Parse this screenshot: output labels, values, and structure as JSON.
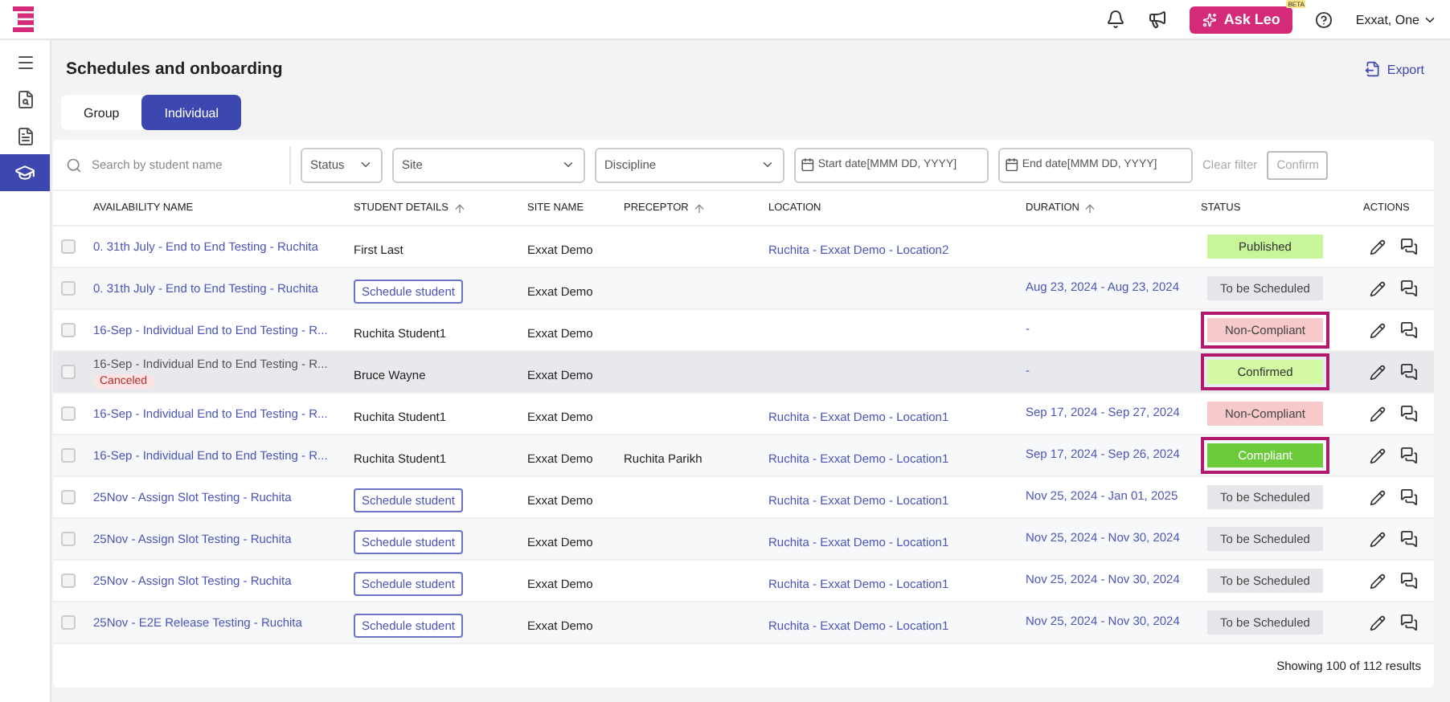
{
  "topbar": {
    "ask_button": "Ask Leo",
    "beta_badge": "BETA",
    "user": "Exxat, One"
  },
  "sidebar": {
    "items": [
      {
        "kind": "menu",
        "selected": false
      },
      {
        "kind": "search-doc",
        "selected": false
      },
      {
        "kind": "doc",
        "selected": false
      },
      {
        "kind": "cap",
        "selected": true
      }
    ]
  },
  "page": {
    "title": "Schedules and onboarding",
    "export": "Export"
  },
  "tabs": [
    {
      "label": "Group",
      "selected": false
    },
    {
      "label": "Individual",
      "selected": true
    }
  ],
  "filters": {
    "search_placeholder": "Search by student name",
    "status": "Status",
    "site": "Site",
    "discipline": "Discipline",
    "start_placeholder": "Start date[MMM DD, YYYY]",
    "end_placeholder": "End date[MMM DD, YYYY]",
    "clear": "Clear filter",
    "confirm": "Confirm"
  },
  "table": {
    "columns": [
      {
        "label": "AVAILABILITY NAME",
        "sortable": false
      },
      {
        "label": "STUDENT DETAILS",
        "sortable": true
      },
      {
        "label": "SITE NAME",
        "sortable": false
      },
      {
        "label": "PRECEPTOR",
        "sortable": true
      },
      {
        "label": "LOCATION",
        "sortable": false
      },
      {
        "label": "DURATION",
        "sortable": true
      },
      {
        "label": "STATUS",
        "sortable": false
      },
      {
        "label": "ACTIONS",
        "sortable": false
      }
    ],
    "rows": [
      {
        "name": "0. 31th July - End to End Testing - Ruchita",
        "canceled": false,
        "student": {
          "kind": "text",
          "text": "First Last"
        },
        "site": "Exxat Demo",
        "preceptor": "",
        "location": "Ruchita - Exxat Demo - Location2",
        "duration": "",
        "status": {
          "kind": "published",
          "text": "Published"
        },
        "highlighted": false
      },
      {
        "name": "0. 31th July - End to End Testing - Ruchita",
        "canceled": false,
        "student": {
          "kind": "button",
          "text": "Schedule student"
        },
        "site": "Exxat Demo",
        "preceptor": "",
        "location": "",
        "duration": "Aug 23, 2024 - Aug 23, 2024",
        "status": {
          "kind": "pending",
          "text": "To be Scheduled"
        },
        "highlighted": false
      },
      {
        "name": "16-Sep - Individual End to End Testing - R...",
        "canceled": false,
        "student": {
          "kind": "text",
          "text": "Ruchita Student1"
        },
        "site": "Exxat Demo",
        "preceptor": "",
        "location": "",
        "duration": "-",
        "status": {
          "kind": "noncompliant",
          "text": "Non-Compliant"
        },
        "highlighted": true
      },
      {
        "name": "16-Sep - Individual End to End Testing - R...",
        "canceled": true,
        "cancel_label": "Canceled",
        "student": {
          "kind": "text",
          "text": "Bruce Wayne"
        },
        "site": "Exxat Demo",
        "preceptor": "",
        "location": "",
        "duration": "-",
        "status": {
          "kind": "confirmed",
          "text": "Confirmed"
        },
        "highlighted": true
      },
      {
        "name": "16-Sep - Individual End to End Testing - R...",
        "canceled": false,
        "student": {
          "kind": "text",
          "text": "Ruchita Student1"
        },
        "site": "Exxat Demo",
        "preceptor": "",
        "location": "Ruchita - Exxat Demo - Location1",
        "duration": "Sep 17, 2024 - Sep 27, 2024",
        "status": {
          "kind": "noncompliant",
          "text": "Non-Compliant"
        },
        "highlighted": false
      },
      {
        "name": "16-Sep - Individual End to End Testing - R...",
        "canceled": false,
        "student": {
          "kind": "text",
          "text": "Ruchita Student1"
        },
        "site": "Exxat Demo",
        "preceptor": "Ruchita Parikh",
        "location": "Ruchita - Exxat Demo - Location1",
        "duration": "Sep 17, 2024 - Sep 26, 2024",
        "status": {
          "kind": "compliant",
          "text": "Compliant"
        },
        "highlighted": true
      },
      {
        "name": "25Nov - Assign Slot Testing - Ruchita",
        "canceled": false,
        "student": {
          "kind": "button",
          "text": "Schedule student"
        },
        "site": "Exxat Demo",
        "preceptor": "",
        "location": "Ruchita - Exxat Demo - Location1",
        "duration": "Nov 25, 2024 - Jan 01, 2025",
        "status": {
          "kind": "pending",
          "text": "To be Scheduled"
        },
        "highlighted": false
      },
      {
        "name": "25Nov - Assign Slot Testing - Ruchita",
        "canceled": false,
        "student": {
          "kind": "button",
          "text": "Schedule student"
        },
        "site": "Exxat Demo",
        "preceptor": "",
        "location": "Ruchita - Exxat Demo - Location1",
        "duration": "Nov 25, 2024 - Nov 30, 2024",
        "status": {
          "kind": "pending",
          "text": "To be Scheduled"
        },
        "highlighted": false
      },
      {
        "name": "25Nov - Assign Slot Testing - Ruchita",
        "canceled": false,
        "student": {
          "kind": "button",
          "text": "Schedule student"
        },
        "site": "Exxat Demo",
        "preceptor": "",
        "location": "Ruchita - Exxat Demo - Location1",
        "duration": "Nov 25, 2024 - Nov 30, 2024",
        "status": {
          "kind": "pending",
          "text": "To be Scheduled"
        },
        "highlighted": false
      },
      {
        "name": "25Nov - E2E Release Testing - Ruchita",
        "canceled": false,
        "student": {
          "kind": "button",
          "text": "Schedule student"
        },
        "site": "Exxat Demo",
        "preceptor": "",
        "location": "Ruchita - Exxat Demo - Location1",
        "duration": "Nov 25, 2024 - Nov 30, 2024",
        "status": {
          "kind": "pending",
          "text": "To be Scheduled"
        },
        "highlighted": false
      }
    ]
  },
  "footer": "Showing 100 of 112 results"
}
